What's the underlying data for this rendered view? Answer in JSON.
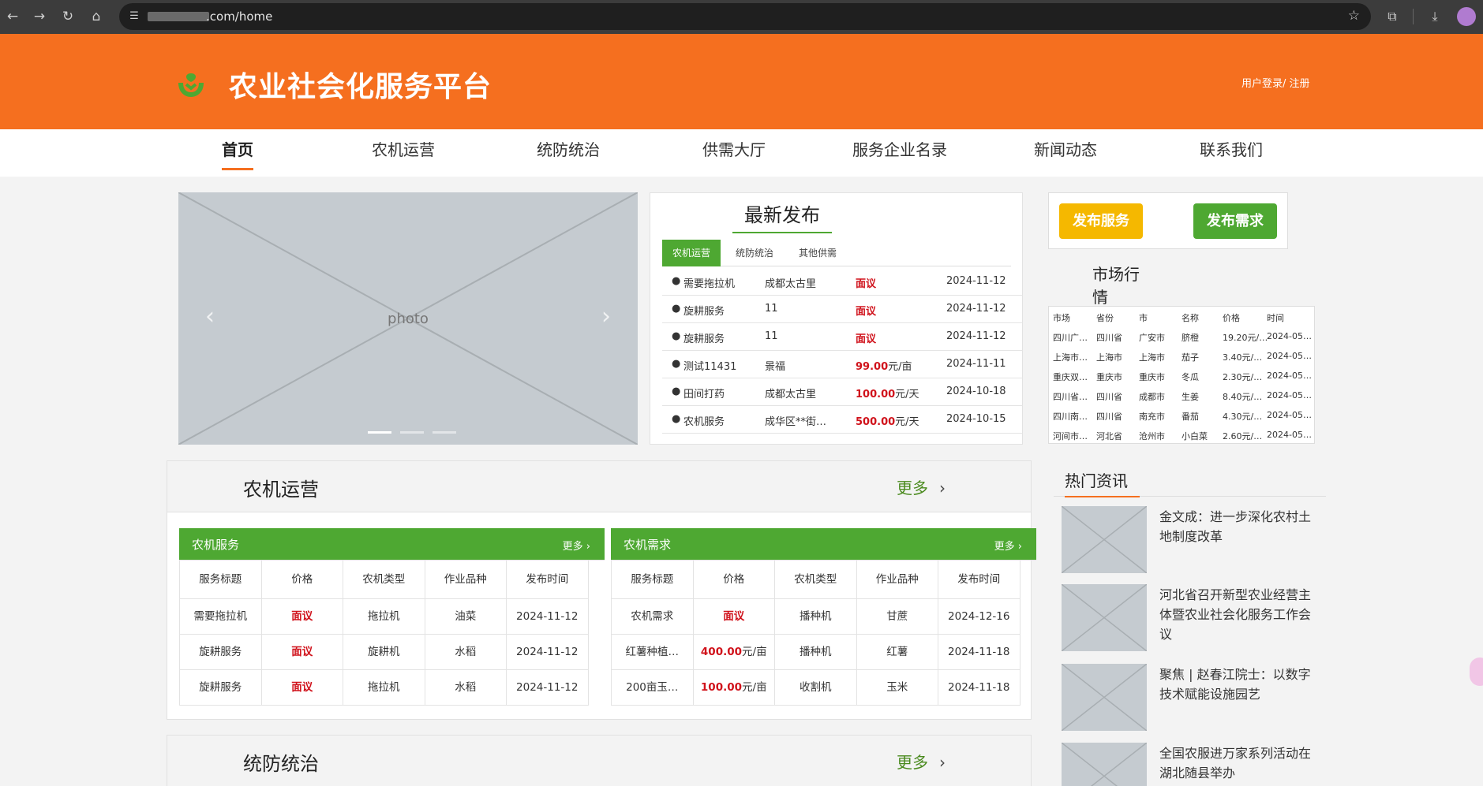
{
  "browser": {
    "url": ".com/home"
  },
  "header": {
    "title": "农业社会化服务平台",
    "login": "用户登录/ 注册"
  },
  "nav": [
    "首页",
    "农机运营",
    "统防统治",
    "供需大厅",
    "服务企业名录",
    "新闻动态",
    "联系我们"
  ],
  "latest": {
    "title": "最新发布",
    "tabs": [
      "农机运营",
      "统防统治",
      "其他供需"
    ],
    "rows": [
      {
        "name": "需要拖拉机",
        "place": "成都太古里",
        "price": "面议",
        "unit": "",
        "date": "2024-11-12"
      },
      {
        "name": "旋耕服务",
        "place": "11",
        "price": "面议",
        "unit": "",
        "date": "2024-11-12"
      },
      {
        "name": "旋耕服务",
        "place": "11",
        "price": "面议",
        "unit": "",
        "date": "2024-11-12"
      },
      {
        "name": "测试11431",
        "place": "景福",
        "price": "99.00",
        "unit": "元/亩",
        "date": "2024-11-11"
      },
      {
        "name": "田间打药",
        "place": "成都太古里",
        "price": "100.00",
        "unit": "元/天",
        "date": "2024-10-18"
      },
      {
        "name": "农机服务",
        "place": "成华区**街…",
        "price": "500.00",
        "unit": "元/天",
        "date": "2024-10-15"
      }
    ]
  },
  "publish": {
    "service": "发布服务",
    "demand": "发布需求"
  },
  "market": {
    "title": "市场行情",
    "headers": [
      "市场",
      "省份",
      "市",
      "名称",
      "价格",
      "时间"
    ],
    "rows": [
      [
        "四川广…",
        "四川省",
        "广安市",
        "脐橙",
        "19.20元/…",
        "2024-05…"
      ],
      [
        "上海市…",
        "上海市",
        "上海市",
        "茄子",
        "3.40元/…",
        "2024-05…"
      ],
      [
        "重庆双…",
        "重庆市",
        "重庆市",
        "冬瓜",
        "2.30元/…",
        "2024-05…"
      ],
      [
        "四川省…",
        "四川省",
        "成都市",
        "生姜",
        "8.40元/…",
        "2024-05…"
      ],
      [
        "四川南…",
        "四川省",
        "南充市",
        "番茄",
        "4.30元/…",
        "2024-05…"
      ],
      [
        "河间市…",
        "河北省",
        "沧州市",
        "小白菜",
        "2.60元/…",
        "2024-05…"
      ]
    ]
  },
  "sections": [
    {
      "title": "农机运营",
      "more": "更多"
    },
    {
      "title": "统防统治",
      "more": "更多"
    }
  ],
  "machine_service": {
    "title": "农机服务",
    "more": "更多",
    "headers": [
      "服务标题",
      "价格",
      "农机类型",
      "作业品种",
      "发布时间"
    ],
    "rows": [
      {
        "title": "需要拖拉机",
        "price": "面议",
        "unit": "",
        "type": "拖拉机",
        "crop": "油菜",
        "date": "2024-11-12"
      },
      {
        "title": "旋耕服务",
        "price": "面议",
        "unit": "",
        "type": "旋耕机",
        "crop": "水稻",
        "date": "2024-11-12"
      },
      {
        "title": "旋耕服务",
        "price": "面议",
        "unit": "",
        "type": "拖拉机",
        "crop": "水稻",
        "date": "2024-11-12"
      }
    ]
  },
  "machine_demand": {
    "title": "农机需求",
    "more": "更多",
    "headers": [
      "服务标题",
      "价格",
      "农机类型",
      "作业品种",
      "发布时间"
    ],
    "rows": [
      {
        "title": "农机需求",
        "price": "面议",
        "unit": "",
        "type": "播种机",
        "crop": "甘蔗",
        "date": "2024-12-16"
      },
      {
        "title": "红薯种植…",
        "price": "400.00",
        "unit": "元/亩",
        "type": "播种机",
        "crop": "红薯",
        "date": "2024-11-18"
      },
      {
        "title": "200亩玉…",
        "price": "100.00",
        "unit": "元/亩",
        "type": "收割机",
        "crop": "玉米",
        "date": "2024-11-18"
      }
    ]
  },
  "hot_news": {
    "title": "热门资讯",
    "items": [
      "金文成：进一步深化农村土地制度改革",
      "河北省召开新型农业经营主体暨农业社会化服务工作会议",
      "聚焦 | 赵春江院士：以数字技术赋能设施园艺",
      "全国农服进万家系列活动在湖北随县举办"
    ]
  }
}
